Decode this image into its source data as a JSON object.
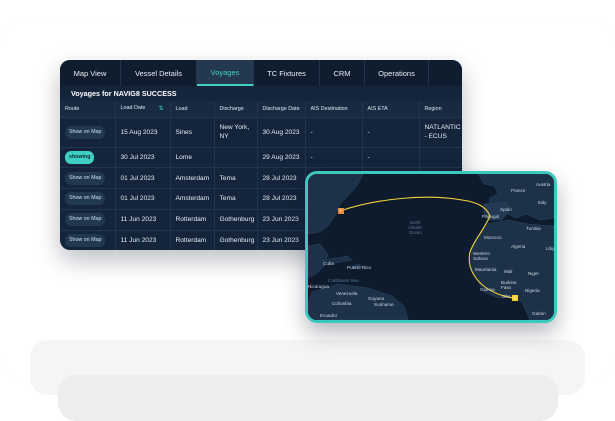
{
  "colors": {
    "accent": "#3fd0c4",
    "panel": "#14243a",
    "route": "#f4d23a",
    "origin_pin": "#f08a2c"
  },
  "tabs": [
    "Map View",
    "Vessel Details",
    "Voyages",
    "TC Fixtures",
    "CRM",
    "Operations"
  ],
  "active_tab": "Voyages",
  "voyages_title": "Voyages for NAVIG8 SUCCESS",
  "columns": [
    "Route",
    "Load Date",
    "Load",
    "Discharge",
    "Discharge Date",
    "AIS Destination",
    "AIS ETA",
    "Region"
  ],
  "sort_icon": "sort-arrows-icon",
  "rows": [
    {
      "route": "Show on Map",
      "load_date": "15 Aug 2023",
      "load": "Sines",
      "discharge": "New York, NY",
      "discharge_date": "30 Aug 2023",
      "ais_dest": "-",
      "ais_eta": "-",
      "region": "NATLANTIC - ECUS"
    },
    {
      "route": "showing",
      "load_date": "30 Jul 2023",
      "load": "Lome",
      "discharge": "",
      "discharge_date": "29 Aug 2023",
      "ais_dest": "-",
      "ais_eta": "-",
      "region": ""
    },
    {
      "route": "Show on Map",
      "load_date": "01 Jul 2023",
      "load": "Amsterdam",
      "discharge": "Tema",
      "discharge_date": "28 Jul 2023",
      "ais_dest": "",
      "ais_eta": "",
      "region": ""
    },
    {
      "route": "Show on Map",
      "load_date": "01 Jul 2023",
      "load": "Amsterdam",
      "discharge": "Tema",
      "discharge_date": "28 Jul 2023",
      "ais_dest": "",
      "ais_eta": "",
      "region": ""
    },
    {
      "route": "Show on Map",
      "load_date": "11 Jun 2023",
      "load": "Rotterdam",
      "discharge": "Gothenburg",
      "discharge_date": "23 Jun 2023",
      "ais_dest": "",
      "ais_eta": "",
      "region": ""
    },
    {
      "route": "Show on Map",
      "load_date": "11 Jun 2023",
      "load": "Rotterdam",
      "discharge": "Gothenburg",
      "discharge_date": "23 Jun 2023",
      "ais_dest": "",
      "ais_eta": "",
      "region": ""
    }
  ],
  "map": {
    "ocean_label": [
      "North",
      "Atlantic",
      "Ocean"
    ],
    "sea_label": "Caribbean Sea",
    "places": {
      "france": "France",
      "austria": "Austria",
      "spain": "Spain",
      "italy": "Italy",
      "portugal": "Portugal",
      "tunisia": "Tunisia",
      "morocco": "Morocco",
      "algeria": "Algeria",
      "libya": "Libya",
      "western_sahara": "Western Sahara",
      "mauritania": "Mauritania",
      "mali": "Mali",
      "niger": "Niger",
      "burkina_faso": "Burkina Faso",
      "guinea": "Guinea",
      "ghana": "Gha",
      "nigeria": "Nigeria",
      "gabon": "Gabon",
      "cuba": "Cuba",
      "puerto_rico": "Puerto Rico",
      "nicaragua": "Nicaragua",
      "venezuela": "Venezuela",
      "guyana": "Guyana",
      "suriname": "Suriname",
      "colombia": "Colombia",
      "ecuador": "Ecuador"
    },
    "pin_origin": "P",
    "pin_dest": "L"
  }
}
